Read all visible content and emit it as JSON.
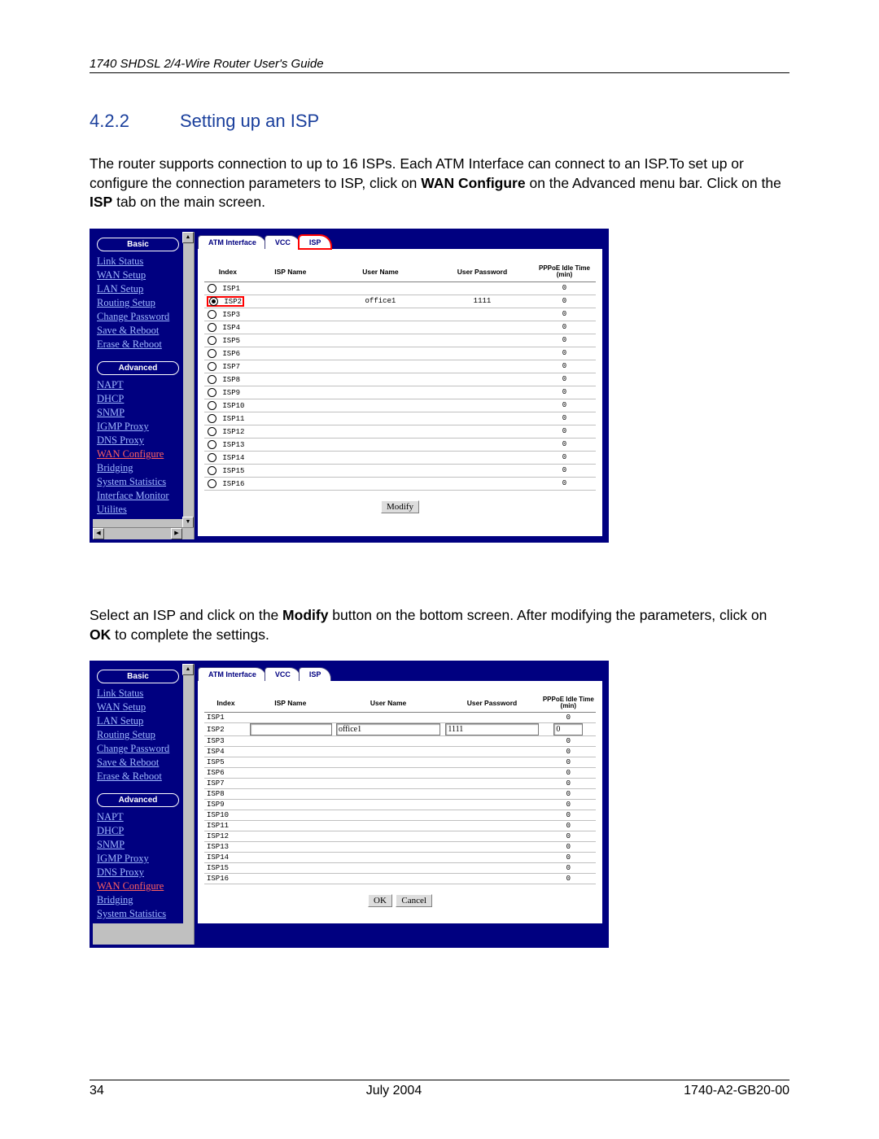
{
  "header": {
    "guide_title": "1740 SHDSL 2/4-Wire Router User's Guide"
  },
  "section": {
    "number": "4.2.2",
    "title": "Setting up an ISP"
  },
  "paragraph1": {
    "p1a": "The router supports connection to up to 16 ISPs. Each ATM Interface can connect to an ISP.To set up or configure the connection parameters to ISP, click on ",
    "p1b": "WAN Configure",
    "p1c": " on the Advanced menu bar. Click on the ",
    "p1d": "ISP",
    "p1e": " tab on the main screen."
  },
  "paragraph2": {
    "p2a": "Select an ISP and click on the ",
    "p2b": "Modify",
    "p2c": " button on the bottom screen. After modifying the parameters, click on ",
    "p2d": "OK",
    "p2e": " to complete the settings."
  },
  "sidebar": {
    "basic_label": "Basic",
    "advanced_label": "Advanced",
    "basic_items": [
      "Link Status",
      "WAN Setup",
      "LAN Setup",
      "Routing Setup",
      "Change Password",
      "Save & Reboot",
      "Erase & Reboot"
    ],
    "advanced_items": [
      "NAPT",
      "DHCP",
      "SNMP",
      "IGMP Proxy",
      "DNS Proxy",
      "WAN Configure",
      "Bridging",
      "System Statistics",
      "Interface Monitor",
      "Utilites"
    ],
    "advanced_items_shot2": [
      "NAPT",
      "DHCP",
      "SNMP",
      "IGMP Proxy",
      "DNS Proxy",
      "WAN Configure",
      "Bridging",
      "System Statistics"
    ]
  },
  "tabs": {
    "atm": "ATM Interface",
    "vcc": "VCC",
    "isp": "ISP"
  },
  "headers": {
    "index": "Index",
    "isp_name": "ISP Name",
    "user_name": "User Name",
    "user_password": "User Password",
    "pppoe": "PPPoE Idle Time (min)"
  },
  "table1_rows": [
    {
      "idx": "ISP1",
      "name": "",
      "user": "",
      "pass": "",
      "idle": "0",
      "sel": false
    },
    {
      "idx": "ISP2",
      "name": "",
      "user": "office1",
      "pass": "1111",
      "idle": "0",
      "sel": true,
      "red": true
    },
    {
      "idx": "ISP3",
      "name": "",
      "user": "",
      "pass": "",
      "idle": "0",
      "sel": false
    },
    {
      "idx": "ISP4",
      "name": "",
      "user": "",
      "pass": "",
      "idle": "0",
      "sel": false
    },
    {
      "idx": "ISP5",
      "name": "",
      "user": "",
      "pass": "",
      "idle": "0",
      "sel": false
    },
    {
      "idx": "ISP6",
      "name": "",
      "user": "",
      "pass": "",
      "idle": "0",
      "sel": false
    },
    {
      "idx": "ISP7",
      "name": "",
      "user": "",
      "pass": "",
      "idle": "0",
      "sel": false
    },
    {
      "idx": "ISP8",
      "name": "",
      "user": "",
      "pass": "",
      "idle": "0",
      "sel": false
    },
    {
      "idx": "ISP9",
      "name": "",
      "user": "",
      "pass": "",
      "idle": "0",
      "sel": false
    },
    {
      "idx": "ISP10",
      "name": "",
      "user": "",
      "pass": "",
      "idle": "0",
      "sel": false
    },
    {
      "idx": "ISP11",
      "name": "",
      "user": "",
      "pass": "",
      "idle": "0",
      "sel": false
    },
    {
      "idx": "ISP12",
      "name": "",
      "user": "",
      "pass": "",
      "idle": "0",
      "sel": false
    },
    {
      "idx": "ISP13",
      "name": "",
      "user": "",
      "pass": "",
      "idle": "0",
      "sel": false
    },
    {
      "idx": "ISP14",
      "name": "",
      "user": "",
      "pass": "",
      "idle": "0",
      "sel": false
    },
    {
      "idx": "ISP15",
      "name": "",
      "user": "",
      "pass": "",
      "idle": "0",
      "sel": false
    },
    {
      "idx": "ISP16",
      "name": "",
      "user": "",
      "pass": "",
      "idle": "0",
      "sel": false
    }
  ],
  "table2_rows": [
    {
      "idx": "ISP1",
      "idle": "0"
    },
    {
      "idx": "ISP2",
      "edit": true,
      "name": "",
      "user": "office1",
      "pass": "1111",
      "idle": "0"
    },
    {
      "idx": "ISP3",
      "idle": "0"
    },
    {
      "idx": "ISP4",
      "idle": "0"
    },
    {
      "idx": "ISP5",
      "idle": "0"
    },
    {
      "idx": "ISP6",
      "idle": "0"
    },
    {
      "idx": "ISP7",
      "idle": "0"
    },
    {
      "idx": "ISP8",
      "idle": "0"
    },
    {
      "idx": "ISP9",
      "idle": "0"
    },
    {
      "idx": "ISP10",
      "idle": "0"
    },
    {
      "idx": "ISP11",
      "idle": "0"
    },
    {
      "idx": "ISP12",
      "idle": "0"
    },
    {
      "idx": "ISP13",
      "idle": "0"
    },
    {
      "idx": "ISP14",
      "idle": "0"
    },
    {
      "idx": "ISP15",
      "idle": "0"
    },
    {
      "idx": "ISP16",
      "idle": "0"
    }
  ],
  "buttons": {
    "modify": "Modify",
    "ok": "OK",
    "cancel": "Cancel"
  },
  "footer": {
    "page": "34",
    "date": "July 2004",
    "doc": "1740-A2-GB20-00"
  }
}
